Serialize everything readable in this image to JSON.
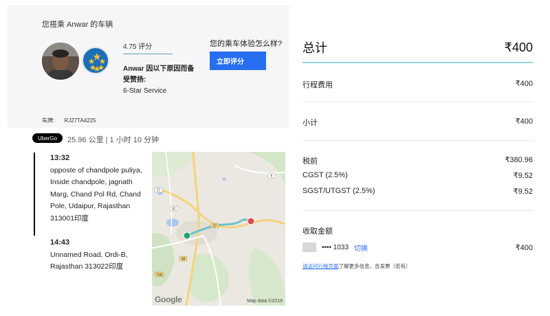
{
  "driver": {
    "heading": "您搭乘 Anwar 的车辆",
    "rating_text": "4.75 评分",
    "commend_title": "Anwar 因以下原因而备受赞扬:",
    "commend_reason": "6-Star Service",
    "experience_question": "您的乘车体验怎么样?",
    "rate_button": "立即评分",
    "plate_label": "车牌:",
    "plate_value": "RJ27TA4225"
  },
  "trip": {
    "product": "UberGo",
    "meta": "25.96 公里 | 1 小时 10 分钟",
    "stops": [
      {
        "time": "13:32",
        "address": "opposte of chandpole puliya, Inside chandpole, jagnath Marg, Chand Pol Rd, Chand Pole, Udaipur, Rajasthan 313001印度"
      },
      {
        "time": "14:43",
        "address": "Unnamed Road, Ordi-B, Rajasthan 313022印度"
      }
    ]
  },
  "map": {
    "attribution": "Map data ©2019",
    "logo": "Google",
    "road_shields": [
      "27",
      "9",
      "32",
      "27",
      "48",
      "76A"
    ]
  },
  "receipt": {
    "total_label": "总计",
    "total_value": "₹400",
    "items": [
      {
        "label": "行程费用",
        "value": "₹400"
      },
      {
        "label": "小计",
        "value": "₹400"
      },
      {
        "label": "税前",
        "value": "₹380.96"
      },
      {
        "label": "CGST (2.5%)",
        "value": "₹9.52"
      },
      {
        "label": "SGST/UTGST (2.5%)",
        "value": "₹9.52"
      }
    ],
    "payment_title": "收取金额",
    "card_masked": "•••• 1033",
    "switch_label": "切换",
    "payment_amount": "₹400",
    "footnote_link": "请访问行程页面",
    "footnote_rest": "了解更多信息，含发票（若有）"
  },
  "colors": {
    "accent_blue": "#276ef1",
    "accent_line": "#8fd1d6",
    "route": "#6cc3c9",
    "start_pin": "#27a56b",
    "end_pin": "#e0474c"
  }
}
